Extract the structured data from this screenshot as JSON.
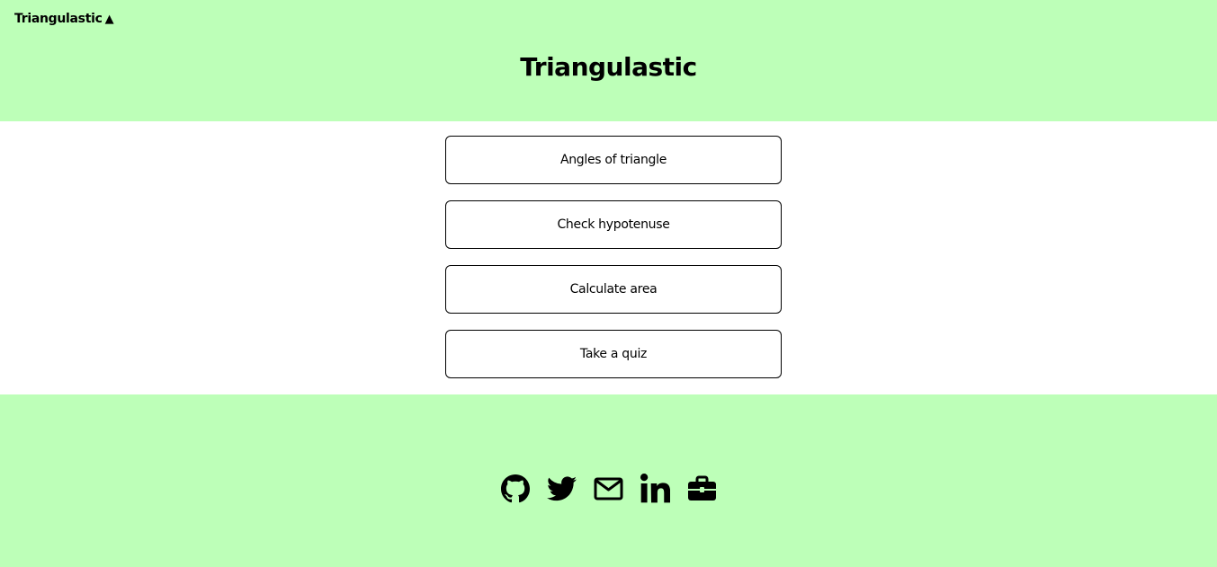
{
  "header": {
    "brand_text": "Triangulastic",
    "brand_symbol": "▲",
    "title": "Triangulastic"
  },
  "menu": {
    "items": [
      {
        "label": "Angles of triangle"
      },
      {
        "label": "Check hypotenuse"
      },
      {
        "label": "Calculate area"
      },
      {
        "label": "Take a quiz"
      }
    ]
  },
  "footer": {
    "social_icons": [
      "github-icon",
      "twitter-icon",
      "mail-icon",
      "linkedin-icon",
      "briefcase-icon"
    ]
  },
  "colors": {
    "header_footer_bg": "#bdffb8",
    "body_bg": "#ffffff",
    "text": "#000000"
  }
}
